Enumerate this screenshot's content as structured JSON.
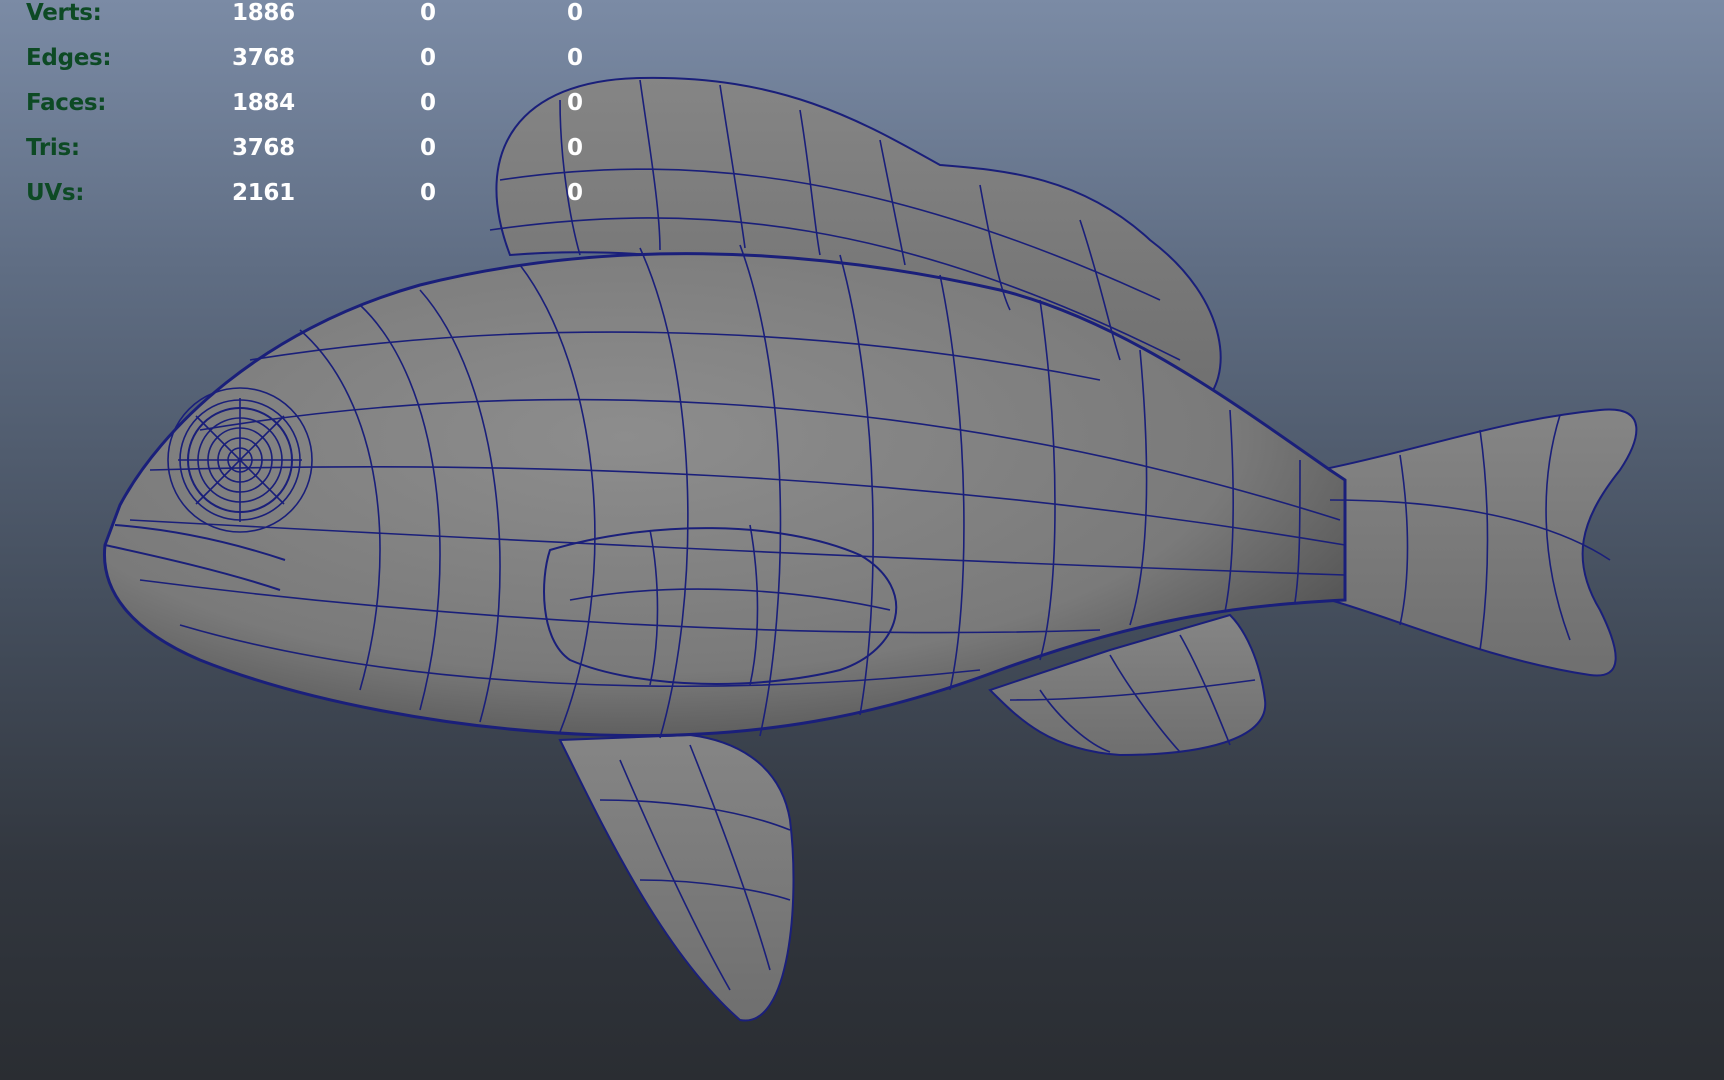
{
  "hud": {
    "rows": [
      {
        "label": "Verts:",
        "values": [
          "1886",
          "0",
          "0"
        ]
      },
      {
        "label": "Edges:",
        "values": [
          "3768",
          "0",
          "0"
        ]
      },
      {
        "label": "Faces:",
        "values": [
          "1884",
          "0",
          "0"
        ]
      },
      {
        "label": "Tris:",
        "values": [
          "3768",
          "0",
          "0"
        ]
      },
      {
        "label": "UVs:",
        "values": [
          "2161",
          "0",
          "0"
        ]
      }
    ]
  },
  "colors": {
    "label_green": "#0d4a24",
    "value_white": "#ffffff",
    "wire_blue": "#1a1f7a",
    "mesh_gray": "#808080"
  },
  "model": {
    "icon": "fish-wireframe-icon"
  }
}
